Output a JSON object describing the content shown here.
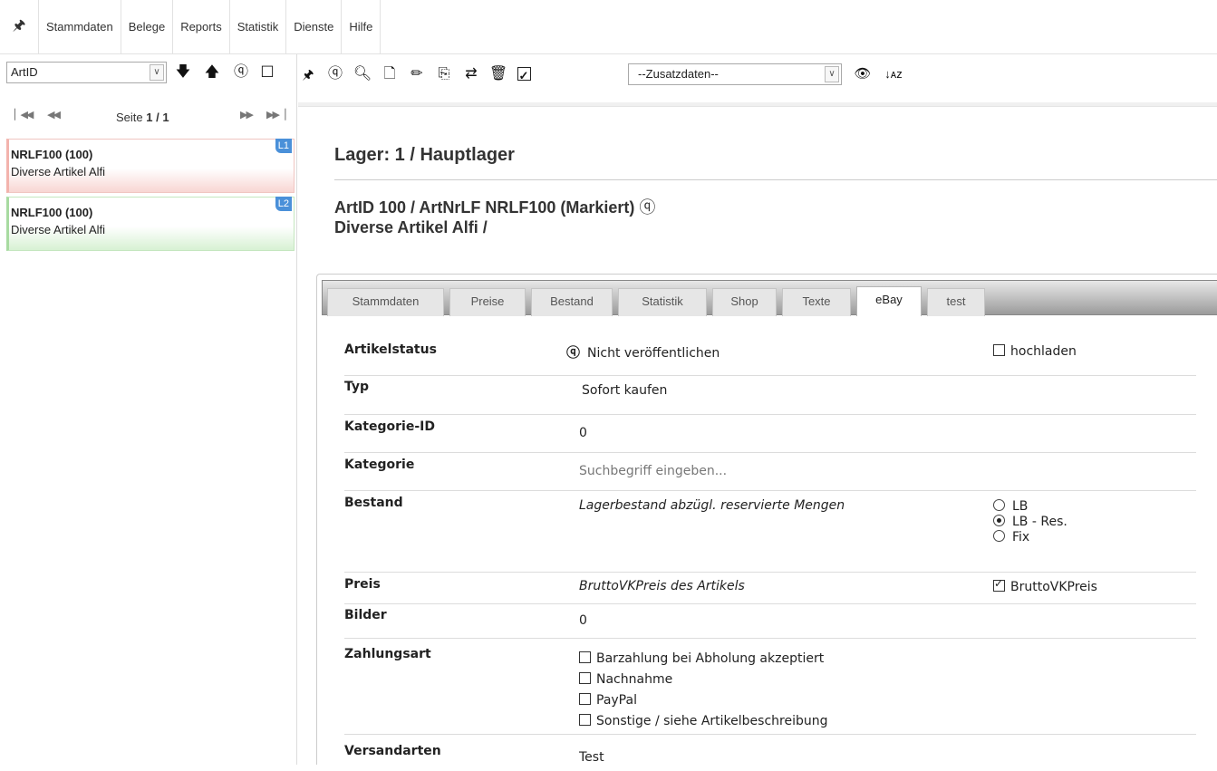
{
  "menu": {
    "items": [
      "Stammdaten",
      "Belege",
      "Reports",
      "Statistik",
      "Dienste",
      "Hilfe"
    ]
  },
  "left": {
    "select_value": "ArtID",
    "pager": {
      "prefix": "Seite",
      "current": "1 / 1"
    },
    "cards": [
      {
        "title": "NRLF100 (100)",
        "subtitle": "Diverse Artikel Alfi",
        "badge": "L1"
      },
      {
        "title": "NRLF100 (100)",
        "subtitle": "Diverse Artikel Alfi",
        "badge": "L2"
      }
    ]
  },
  "toolbar": {
    "zusatz_value": "--Zusatzdaten--"
  },
  "header": {
    "lager": "Lager: 1 / Hauptlager",
    "article_line1": "ArtID 100 / ArtNrLF NRLF100  (Markiert)",
    "article_line2": "Diverse Artikel Alfi /"
  },
  "tabs": [
    {
      "label": "Stammdaten",
      "active": false
    },
    {
      "label": "Preise",
      "active": false
    },
    {
      "label": "Bestand",
      "active": false
    },
    {
      "label": "Statistik",
      "active": false
    },
    {
      "label": "Shop",
      "active": false
    },
    {
      "label": "Texte",
      "active": false
    },
    {
      "label": "eBay",
      "active": true
    },
    {
      "label": "test",
      "active": false
    }
  ],
  "ebay": {
    "artikelstatus": {
      "label": "Artikelstatus",
      "value": "Nicht veröffentlichen",
      "upload_label": "hochladen",
      "upload_checked": false
    },
    "typ": {
      "label": "Typ",
      "value": "Sofort kaufen"
    },
    "kategorie_id": {
      "label": "Kategorie-ID",
      "value": "0"
    },
    "kategorie": {
      "label": "Kategorie",
      "placeholder": "Suchbegriff eingeben..."
    },
    "bestand": {
      "label": "Bestand",
      "value": "Lagerbestand abzügl. reservierte Mengen",
      "options": [
        {
          "label": "LB",
          "checked": false
        },
        {
          "label": "LB - Res.",
          "checked": true
        },
        {
          "label": "Fix",
          "checked": false
        }
      ]
    },
    "preis": {
      "label": "Preis",
      "value": "BruttoVKPreis des Artikels",
      "option_label": "BruttoVKPreis",
      "option_checked": true
    },
    "bilder": {
      "label": "Bilder",
      "value": "0"
    },
    "zahlungsart": {
      "label": "Zahlungsart",
      "options": [
        {
          "label": "Barzahlung bei Abholung akzeptiert",
          "checked": false
        },
        {
          "label": "Nachnahme",
          "checked": false
        },
        {
          "label": "PayPal",
          "checked": false
        },
        {
          "label": "Sonstige / siehe Artikelbeschreibung",
          "checked": false
        }
      ]
    },
    "versandarten": {
      "label": "Versandarten",
      "value": "Test"
    }
  }
}
